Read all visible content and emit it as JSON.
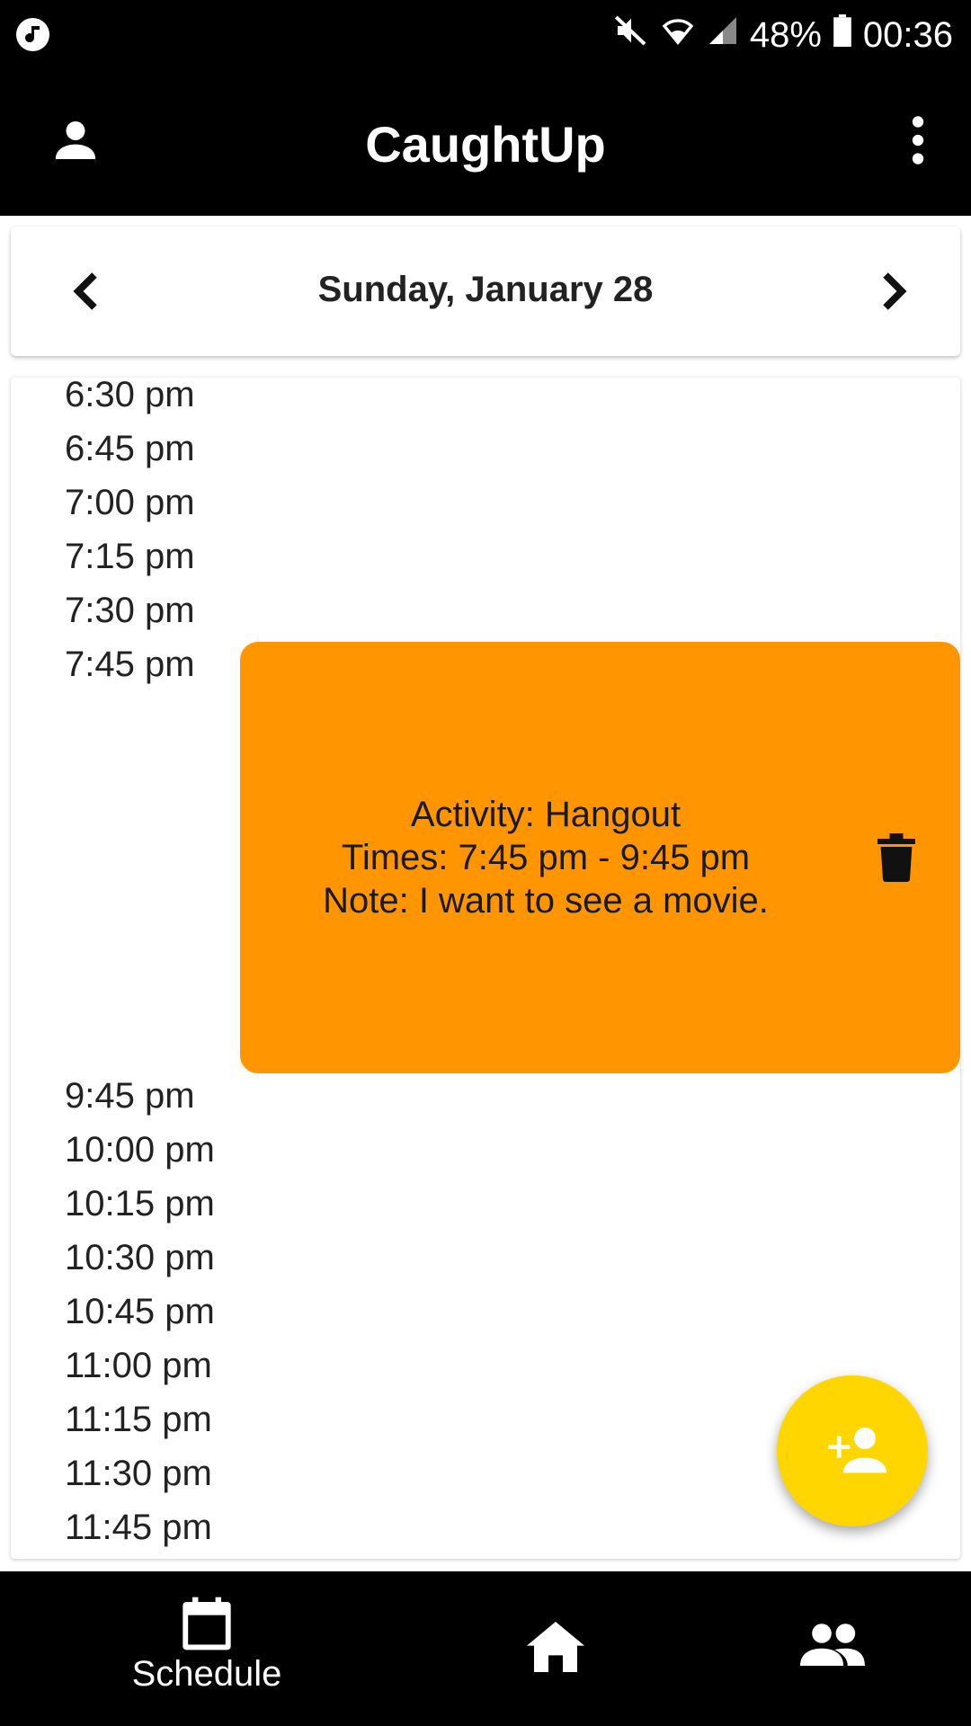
{
  "status_bar": {
    "battery": "48%",
    "time": "00:36",
    "icons": [
      "music-icon",
      "mute-icon",
      "wifi-icon",
      "signal-icon",
      "battery-icon"
    ]
  },
  "app_bar": {
    "title": "CaughtUp",
    "left_icon": "profile-icon",
    "right_icon": "more-vert-icon"
  },
  "date_nav": {
    "date": "Sunday, January 28",
    "prev_icon": "chevron-left-icon",
    "next_icon": "chevron-right-icon"
  },
  "schedule": {
    "slots_before": [
      "6:30 pm",
      "6:45 pm",
      "7:00 pm",
      "7:15 pm",
      "7:30 pm",
      "7:45 pm"
    ],
    "event": {
      "activity": "Activity: Hangout",
      "times": "Times: 7:45 pm - 9:45 pm",
      "note": "Note: I want to see a movie.",
      "color": "#ff9500",
      "action_icon": "trash-icon"
    },
    "slots_after": [
      "9:45 pm",
      "10:00 pm",
      "10:15 pm",
      "10:30 pm",
      "10:45 pm",
      "11:00 pm",
      "11:15 pm",
      "11:30 pm",
      "11:45 pm"
    ]
  },
  "fab": {
    "icon": "add-person-icon",
    "color": "#ffd600"
  },
  "bottom_nav": {
    "items": [
      {
        "label": "Schedule",
        "icon": "calendar-icon"
      },
      {
        "label": "",
        "icon": "home-icon"
      },
      {
        "label": "",
        "icon": "group-icon"
      }
    ]
  }
}
